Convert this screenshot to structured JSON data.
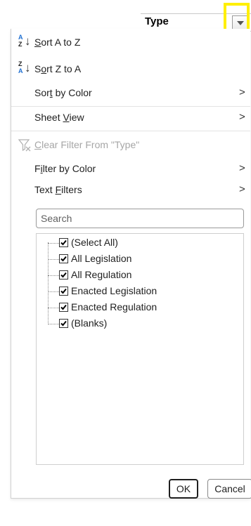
{
  "header": {
    "column_title": "Type",
    "dropdown_icon": "chevron-down-icon",
    "highlight_color": "#ffef00"
  },
  "menu": {
    "sort_a_to_z": {
      "label_pre": "",
      "label_u": "S",
      "label_post": "ort A to Z",
      "icon_top": "A",
      "icon_bottom": "Z",
      "icon": "sort-ascending-icon"
    },
    "sort_z_to_a": {
      "label_pre": "S",
      "label_u": "o",
      "label_post": "rt Z to A",
      "icon_top": "Z",
      "icon_bottom": "A",
      "icon": "sort-descending-icon"
    },
    "sort_by_color": {
      "label_pre": "Sor",
      "label_u": "t",
      "label_post": " by Color",
      "chevron": ">"
    },
    "sheet_view": {
      "label_pre": "Sheet ",
      "label_u": "V",
      "label_post": "iew",
      "chevron": ">"
    },
    "clear_filter": {
      "label_pre": "",
      "label_u": "C",
      "label_post": "lear Filter From \"Type\"",
      "icon": "clear-filter-icon"
    },
    "filter_by_color": {
      "label_pre": "F",
      "label_u": "i",
      "label_post": "lter by Color",
      "chevron": ">"
    },
    "text_filters": {
      "label_pre": "Text ",
      "label_u": "F",
      "label_post": "ilters",
      "chevron": ">"
    }
  },
  "search": {
    "placeholder": "Search",
    "value": ""
  },
  "filter_list": [
    {
      "label": "(Select All)",
      "checked": true
    },
    {
      "label": "All Legislation",
      "checked": true
    },
    {
      "label": "All Regulation",
      "checked": true
    },
    {
      "label": "Enacted Legislation",
      "checked": true
    },
    {
      "label": "Enacted Regulation",
      "checked": true
    },
    {
      "label": "(Blanks)",
      "checked": true
    }
  ],
  "buttons": {
    "ok": "OK",
    "cancel": "Cancel"
  },
  "colors": {
    "accent_blue": "#1e6fd1",
    "disabled_text": "#a6a6a6"
  }
}
